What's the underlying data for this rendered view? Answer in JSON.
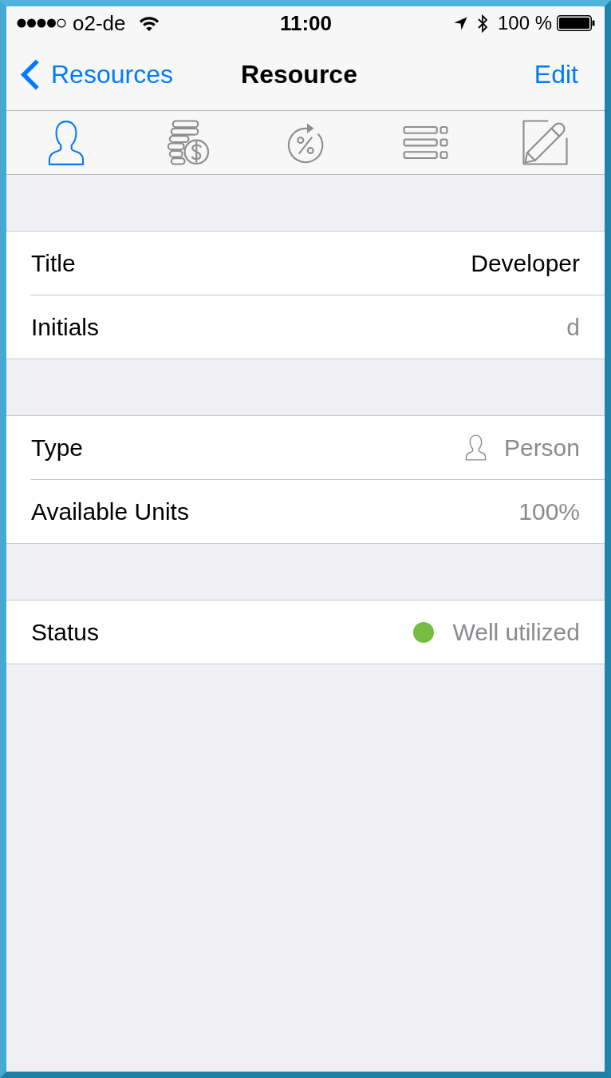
{
  "status_bar": {
    "carrier": "o2-de",
    "time": "11:00",
    "battery": "100 %"
  },
  "nav_bar": {
    "back": "Resources",
    "title": "Resource",
    "action": "Edit"
  },
  "tabs": [
    {
      "kind": "person",
      "selected": true
    },
    {
      "kind": "costs",
      "selected": false
    },
    {
      "kind": "percent",
      "selected": false
    },
    {
      "kind": "list",
      "selected": false
    },
    {
      "kind": "edit",
      "selected": false
    }
  ],
  "sections": [
    {
      "rows": [
        {
          "kind": "text",
          "label": "Title",
          "value": "Developer"
        },
        {
          "kind": "detail",
          "label": "Initials",
          "value": "d"
        }
      ]
    },
    {
      "rows": [
        {
          "kind": "type",
          "label": "Type",
          "value": "Person"
        },
        {
          "kind": "detail",
          "label": "Available Units",
          "value": "100%"
        }
      ]
    },
    {
      "rows": [
        {
          "kind": "status",
          "label": "Status",
          "value": "Well utilized",
          "color": "#76bc43"
        }
      ]
    }
  ]
}
